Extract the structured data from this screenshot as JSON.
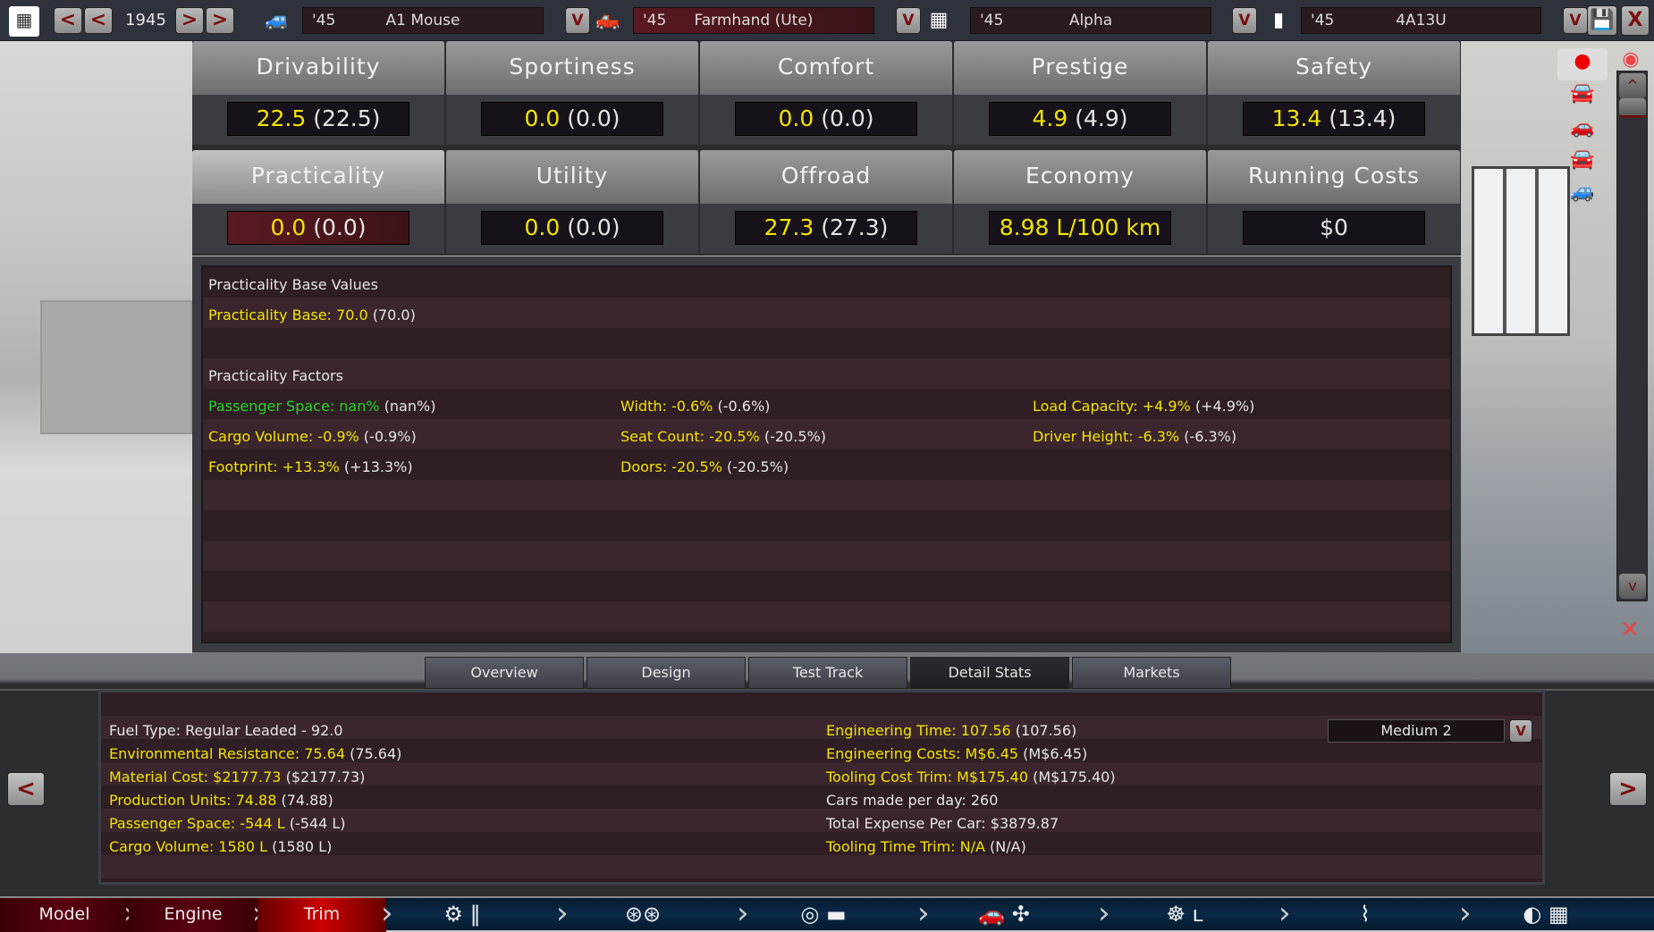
{
  "topbar": {
    "year": "1945",
    "prev2": "<",
    "prev1": "<",
    "next1": ">",
    "next2": ">",
    "selectors": [
      {
        "year": "'45",
        "name": "A1 Mouse",
        "icon": "car-model-icon"
      },
      {
        "year": "'45",
        "name": "Farmhand (Ute)",
        "icon": "trim-icon"
      },
      {
        "year": "'45",
        "name": "Alpha",
        "icon": "engine-family-icon"
      },
      {
        "year": "'45",
        "name": "4A13U",
        "icon": "engine-variant-icon"
      }
    ],
    "dropdown": "V",
    "close": "X"
  },
  "stats": [
    {
      "label": "Drivability",
      "value": "22.5",
      "prev": "(22.5)"
    },
    {
      "label": "Sportiness",
      "value": "0.0",
      "prev": "(0.0)"
    },
    {
      "label": "Comfort",
      "value": "0.0",
      "prev": "(0.0)"
    },
    {
      "label": "Prestige",
      "value": "4.9",
      "prev": "(4.9)"
    },
    {
      "label": "Safety",
      "value": "13.4",
      "prev": "(13.4)"
    },
    {
      "label": "Practicality",
      "value": "0.0",
      "prev": "(0.0)",
      "active": true
    },
    {
      "label": "Utility",
      "value": "0.0",
      "prev": "(0.0)"
    },
    {
      "label": "Offroad",
      "value": "27.3",
      "prev": "(27.3)"
    },
    {
      "label": "Economy",
      "value": "8.98 L/100 km",
      "prev": ""
    },
    {
      "label": "Running Costs",
      "value": "$0",
      "prev": "",
      "white": true
    }
  ],
  "detail": {
    "base_title": "Practicality Base Values",
    "base": {
      "label": "Practicality Base: 70.0",
      "prev": " (70.0)"
    },
    "factors_title": "Practicality Factors",
    "factors": [
      {
        "label": "Passenger Space: nan%",
        "prev": " (nan%)",
        "color": "green"
      },
      {
        "label": "Width: -0.6%",
        "prev": " (-0.6%)"
      },
      {
        "label": "Load Capacity: +4.9%",
        "prev": " (+4.9%)"
      },
      {
        "label": "Cargo Volume: -0.9%",
        "prev": " (-0.9%)"
      },
      {
        "label": "Seat Count: -20.5%",
        "prev": " (-20.5%)"
      },
      {
        "label": "Driver Height: -6.3%",
        "prev": " (-6.3%)"
      },
      {
        "label": "Footprint: +13.3%",
        "prev": " (+13.3%)"
      },
      {
        "label": "Doors: -20.5%",
        "prev": " (-20.5%)"
      }
    ]
  },
  "tabs": [
    {
      "label": "Overview"
    },
    {
      "label": "Design"
    },
    {
      "label": "Test Track"
    },
    {
      "label": "Detail Stats",
      "active": true
    },
    {
      "label": "Markets"
    }
  ],
  "info": {
    "left": [
      {
        "label": "Fuel Type: Regular Leaded - 92.0",
        "prev": "",
        "white": true
      },
      {
        "label": "Environmental Resistance: 75.64",
        "prev": " (75.64)"
      },
      {
        "label": "Material Cost: $2177.73",
        "prev": " ($2177.73)"
      },
      {
        "label": "Production Units: 74.88",
        "prev": " (74.88)"
      },
      {
        "label": "Passenger Space: -544 L",
        "prev": " (-544 L)"
      },
      {
        "label": "Cargo Volume: 1580 L",
        "prev": " (1580 L)"
      }
    ],
    "right": [
      {
        "label": "Engineering Time: 107.56",
        "prev": " (107.56)"
      },
      {
        "label": "Engineering Costs: M$6.45",
        "prev": " (M$6.45)"
      },
      {
        "label": "Tooling Cost Trim: M$175.40",
        "prev": " (M$175.40)"
      },
      {
        "label": "Cars made per day: 260",
        "prev": "",
        "white": true
      },
      {
        "label": "Total Expense Per Car: $3879.87",
        "prev": "",
        "white": true
      },
      {
        "label": "Tooling Time Trim: N/A",
        "prev": " (N/A)"
      }
    ],
    "quality": "Medium 2"
  },
  "nav": {
    "items": [
      {
        "label": "Model"
      },
      {
        "label": "Engine"
      },
      {
        "label": "Trim",
        "active": true
      }
    ],
    "icons": [
      "chassis-gearbox-icon",
      "wheels-icon",
      "fixture-body-icon",
      "car-aero-icon",
      "interior-icon",
      "suspension-icon",
      "test-drive-icon"
    ]
  },
  "arrows": {
    "left": "<",
    "right": ">"
  },
  "scroll": {
    "up": "^",
    "down": "v"
  },
  "colors": {
    "yellow": "#f2e400",
    "green": "#27d427",
    "accent": "#7a0e0e"
  }
}
